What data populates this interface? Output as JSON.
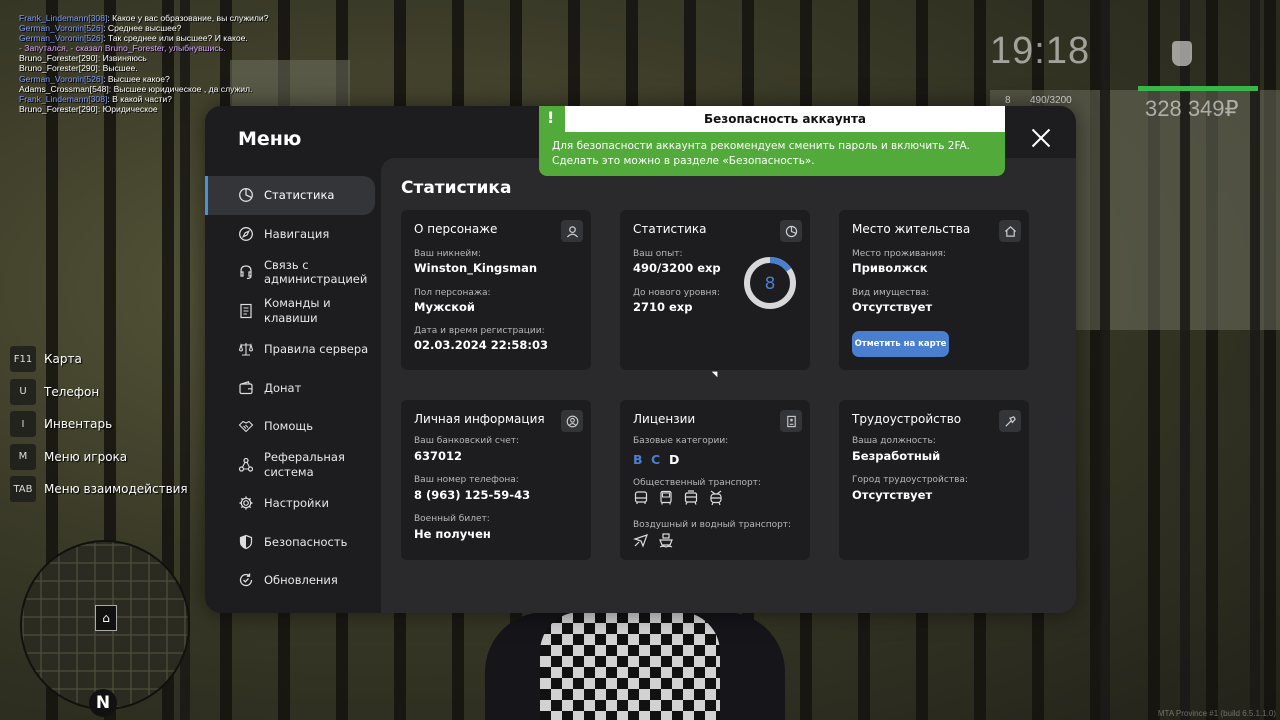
{
  "chat": [
    {
      "name": "Frank_Lindemann[308]",
      "text": ": Какое у вас образование, вы служили?"
    },
    {
      "name": "German_Voronin[526]",
      "text": ": Среднее высшее?"
    },
    {
      "name": "German_Voronin[526]",
      "text": ": Так среднее или высшее? И какое."
    },
    {
      "emote": "- Запутался, - сказал Bruno_Forester, улыбнувшись."
    },
    {
      "plain": "Bruno_Forester[290]: Извиняюсь"
    },
    {
      "plain": "Bruno_Forester[290]: Высшее."
    },
    {
      "name": "German_Voronin[526]",
      "text": ": Высшее какое?"
    },
    {
      "plain": "Adams_Crossman[548]: Высшее юридическое , да служил."
    },
    {
      "name": "Frank_Lindemann[308]",
      "text": ": В какой части?"
    },
    {
      "plain": "Bruno_Forester[290]: Юридическое"
    }
  ],
  "hud": {
    "time": "19:18",
    "money": "328 349₽",
    "level": "8",
    "exp": "490/3200",
    "colors": {
      "health": "#39b54a"
    }
  },
  "hotkeys": [
    {
      "key": "F11",
      "label": "Карта"
    },
    {
      "key": "U",
      "label": "Телефон"
    },
    {
      "key": "I",
      "label": "Инвентарь"
    },
    {
      "key": "M",
      "label": "Меню игрока"
    },
    {
      "key": "TAB",
      "label": "Меню взаимодействия"
    }
  ],
  "minimap": {
    "compass": "N"
  },
  "menu": {
    "title": "Меню",
    "sidebar": [
      {
        "label": "Статистика",
        "icon": "pie-chart-icon",
        "active": true
      },
      {
        "label": "Навигация",
        "icon": "compass-icon"
      },
      {
        "label": "Связь с администрацией",
        "icon": "headset-icon"
      },
      {
        "label": "Команды и клавиши",
        "icon": "document-icon"
      },
      {
        "label": "Правила сервера",
        "icon": "scales-icon"
      },
      {
        "label": "Донат",
        "icon": "wallet-icon"
      },
      {
        "label": "Помощь",
        "icon": "handshake-icon"
      },
      {
        "label": "Реферальная система",
        "icon": "network-icon"
      },
      {
        "label": "Настройки",
        "icon": "gear-icon"
      },
      {
        "label": "Безопасность",
        "icon": "shield-icon"
      },
      {
        "label": "Обновления",
        "icon": "refresh-icon"
      }
    ],
    "content_title": "Статистика",
    "character": {
      "title": "О персонаже",
      "icon": "user-icon",
      "nick_label": "Ваш никнейм:",
      "nick": "Winston_Kingsman",
      "gender_label": "Пол персонажа:",
      "gender": "Мужской",
      "reg_label": "Дата и время регистрации:",
      "reg": "02.03.2024 22:58:03"
    },
    "stats": {
      "title": "Статистика",
      "icon": "pie-chart-icon",
      "exp_label": "Ваш опыт:",
      "exp": "490/3200 exp",
      "next_label": "До нового уровня:",
      "next": "2710 exp",
      "level": "8",
      "level_progress": 0.153
    },
    "residence": {
      "title": "Место жительства",
      "icon": "home-icon",
      "place_label": "Место проживания:",
      "place": "Приволжск",
      "property_label": "Вид имущества:",
      "property": "Отсутствует",
      "button": "Отметить на карте"
    },
    "personal": {
      "title": "Личная информация",
      "icon": "account-circle-icon",
      "bank_label": "Ваш банковский счет:",
      "bank": "637012",
      "phone_label": "Ваш номер телефона:",
      "phone": "8 (963) 125-59-43",
      "military_label": "Военный билет:",
      "military": "Не получен"
    },
    "licenses": {
      "title": "Лицензии",
      "icon": "id-card-icon",
      "base_label": "Базовые категории:",
      "categories": [
        {
          "letter": "B",
          "color": "#4a7fd0"
        },
        {
          "letter": "C",
          "color": "#4a7fd0"
        },
        {
          "letter": "D",
          "color": "#ffffff"
        }
      ],
      "public_label": "Общественный транспорт:",
      "public_icons": [
        "bus-icon",
        "bus-front-icon",
        "tram-icon",
        "trolley-icon"
      ],
      "air_label": "Воздушный и водный транспорт:",
      "air_icons": [
        "plane-icon",
        "boat-icon"
      ]
    },
    "employment": {
      "title": "Трудоустройство",
      "icon": "hammer-icon",
      "job_label": "Ваша должность:",
      "job": "Безработный",
      "city_label": "Город трудоустройства:",
      "city": "Отсутствует"
    }
  },
  "notice": {
    "title": "Безопасность аккаунта",
    "text": "Для безопасности аккаунта рекомендуем сменить пароль и включить 2FA. Сделать это можно в разделе «Безопасность».",
    "bang": "!"
  },
  "build": "MTA Province #1 (build 6.5.1.1.0)"
}
